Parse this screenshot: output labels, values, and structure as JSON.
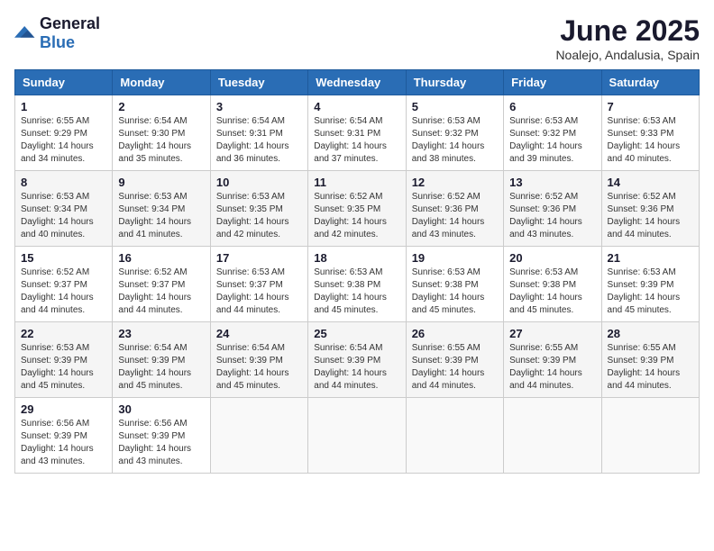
{
  "header": {
    "logo": {
      "general": "General",
      "blue": "Blue"
    },
    "title": "June 2025",
    "location": "Noalejo, Andalusia, Spain"
  },
  "calendar": {
    "days_of_week": [
      "Sunday",
      "Monday",
      "Tuesday",
      "Wednesday",
      "Thursday",
      "Friday",
      "Saturday"
    ],
    "weeks": [
      [
        null,
        {
          "day": 2,
          "sunrise": "6:54 AM",
          "sunset": "9:30 PM",
          "daylight": "14 hours and 35 minutes."
        },
        {
          "day": 3,
          "sunrise": "6:54 AM",
          "sunset": "9:31 PM",
          "daylight": "14 hours and 36 minutes."
        },
        {
          "day": 4,
          "sunrise": "6:54 AM",
          "sunset": "9:31 PM",
          "daylight": "14 hours and 37 minutes."
        },
        {
          "day": 5,
          "sunrise": "6:53 AM",
          "sunset": "9:32 PM",
          "daylight": "14 hours and 38 minutes."
        },
        {
          "day": 6,
          "sunrise": "6:53 AM",
          "sunset": "9:32 PM",
          "daylight": "14 hours and 39 minutes."
        },
        {
          "day": 7,
          "sunrise": "6:53 AM",
          "sunset": "9:33 PM",
          "daylight": "14 hours and 40 minutes."
        }
      ],
      [
        {
          "day": 1,
          "sunrise": "6:55 AM",
          "sunset": "9:29 PM",
          "daylight": "14 hours and 34 minutes."
        },
        {
          "day": 9,
          "sunrise": "6:53 AM",
          "sunset": "9:34 PM",
          "daylight": "14 hours and 41 minutes."
        },
        {
          "day": 10,
          "sunrise": "6:53 AM",
          "sunset": "9:35 PM",
          "daylight": "14 hours and 42 minutes."
        },
        {
          "day": 11,
          "sunrise": "6:52 AM",
          "sunset": "9:35 PM",
          "daylight": "14 hours and 42 minutes."
        },
        {
          "day": 12,
          "sunrise": "6:52 AM",
          "sunset": "9:36 PM",
          "daylight": "14 hours and 43 minutes."
        },
        {
          "day": 13,
          "sunrise": "6:52 AM",
          "sunset": "9:36 PM",
          "daylight": "14 hours and 43 minutes."
        },
        {
          "day": 14,
          "sunrise": "6:52 AM",
          "sunset": "9:36 PM",
          "daylight": "14 hours and 44 minutes."
        }
      ],
      [
        {
          "day": 8,
          "sunrise": "6:53 AM",
          "sunset": "9:34 PM",
          "daylight": "14 hours and 40 minutes."
        },
        {
          "day": 16,
          "sunrise": "6:52 AM",
          "sunset": "9:37 PM",
          "daylight": "14 hours and 44 minutes."
        },
        {
          "day": 17,
          "sunrise": "6:53 AM",
          "sunset": "9:37 PM",
          "daylight": "14 hours and 44 minutes."
        },
        {
          "day": 18,
          "sunrise": "6:53 AM",
          "sunset": "9:38 PM",
          "daylight": "14 hours and 45 minutes."
        },
        {
          "day": 19,
          "sunrise": "6:53 AM",
          "sunset": "9:38 PM",
          "daylight": "14 hours and 45 minutes."
        },
        {
          "day": 20,
          "sunrise": "6:53 AM",
          "sunset": "9:38 PM",
          "daylight": "14 hours and 45 minutes."
        },
        {
          "day": 21,
          "sunrise": "6:53 AM",
          "sunset": "9:39 PM",
          "daylight": "14 hours and 45 minutes."
        }
      ],
      [
        {
          "day": 15,
          "sunrise": "6:52 AM",
          "sunset": "9:37 PM",
          "daylight": "14 hours and 44 minutes."
        },
        {
          "day": 23,
          "sunrise": "6:54 AM",
          "sunset": "9:39 PM",
          "daylight": "14 hours and 45 minutes."
        },
        {
          "day": 24,
          "sunrise": "6:54 AM",
          "sunset": "9:39 PM",
          "daylight": "14 hours and 45 minutes."
        },
        {
          "day": 25,
          "sunrise": "6:54 AM",
          "sunset": "9:39 PM",
          "daylight": "14 hours and 44 minutes."
        },
        {
          "day": 26,
          "sunrise": "6:55 AM",
          "sunset": "9:39 PM",
          "daylight": "14 hours and 44 minutes."
        },
        {
          "day": 27,
          "sunrise": "6:55 AM",
          "sunset": "9:39 PM",
          "daylight": "14 hours and 44 minutes."
        },
        {
          "day": 28,
          "sunrise": "6:55 AM",
          "sunset": "9:39 PM",
          "daylight": "14 hours and 44 minutes."
        }
      ],
      [
        {
          "day": 22,
          "sunrise": "6:53 AM",
          "sunset": "9:39 PM",
          "daylight": "14 hours and 45 minutes."
        },
        {
          "day": 30,
          "sunrise": "6:56 AM",
          "sunset": "9:39 PM",
          "daylight": "14 hours and 43 minutes."
        },
        null,
        null,
        null,
        null,
        null
      ],
      [
        {
          "day": 29,
          "sunrise": "6:56 AM",
          "sunset": "9:39 PM",
          "daylight": "14 hours and 43 minutes."
        },
        null,
        null,
        null,
        null,
        null,
        null
      ]
    ]
  }
}
